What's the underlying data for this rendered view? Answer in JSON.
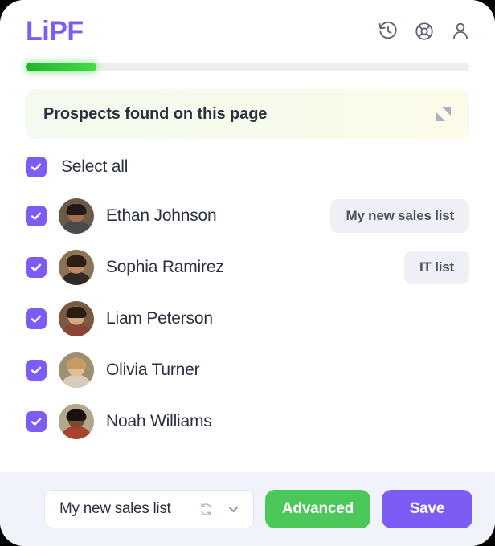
{
  "header": {
    "brand": "LiPF",
    "icons": [
      {
        "name": "history-icon",
        "label": "History"
      },
      {
        "name": "lifebuoy-icon",
        "label": "Support"
      },
      {
        "name": "user-icon",
        "label": "Account"
      }
    ]
  },
  "progress": {
    "percent": 16,
    "fill_color": "#3fd845",
    "track_color": "#eeeeee"
  },
  "banner": {
    "title": "Prospects found on this page",
    "collapse_icon": "collapse-icon"
  },
  "list": {
    "select_all_label": "Select all",
    "select_all_checked": true,
    "prospects": [
      {
        "name": "Ethan Johnson",
        "checked": true,
        "badge": "My new sales list",
        "skin": "#a3704f",
        "hair": "#221a14",
        "shirt": "#4a4a50",
        "bg": "#6b5a48"
      },
      {
        "name": "Sophia Ramirez",
        "checked": true,
        "badge": "IT list",
        "skin": "#c08a63",
        "hair": "#2d1f16",
        "shirt": "#2f2a26",
        "bg": "#8a7456"
      },
      {
        "name": "Liam Peterson",
        "checked": true,
        "badge": "",
        "skin": "#d6a882",
        "hair": "#2a1d13",
        "shirt": "#8a4535",
        "bg": "#7a5a42"
      },
      {
        "name": "Olivia Turner",
        "checked": true,
        "badge": "",
        "skin": "#e3bb95",
        "hair": "#c79a63",
        "shirt": "#d8cbbd",
        "bg": "#9b9070"
      },
      {
        "name": "Noah Williams",
        "checked": true,
        "badge": "",
        "skin": "#7a4a30",
        "hair": "#171210",
        "shirt": "#a8432f",
        "bg": "#b4a58f"
      }
    ]
  },
  "footer": {
    "list_select_value": "My new sales list",
    "refresh_icon": "refresh-icon",
    "chevron_icon": "chevron-down-icon",
    "advanced_label": "Advanced",
    "save_label": "Save"
  },
  "colors": {
    "brand_purple": "#7C5CF5",
    "green": "#4CC85A",
    "badge_bg": "#eef0f6",
    "footer_bg": "#f1f3fb",
    "text_dark": "#2b3040"
  }
}
